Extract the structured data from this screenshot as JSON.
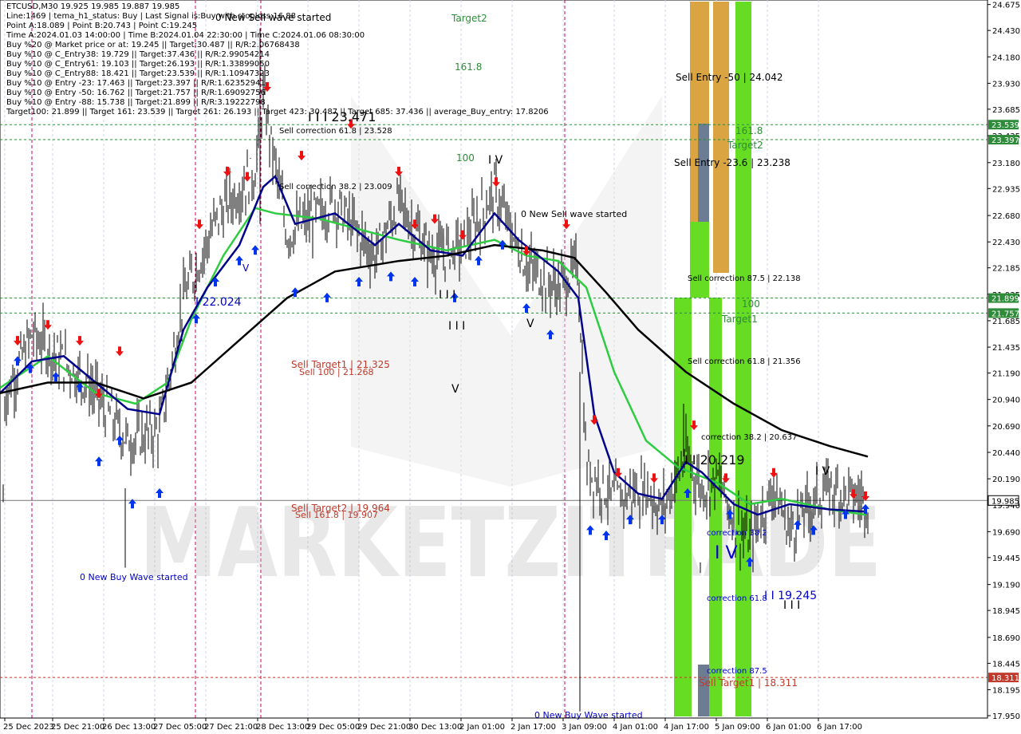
{
  "chart_data": {
    "type": "candlestick",
    "symbol_header": "ETCUSD,M30  19.925 19.985 19.887 19.985",
    "info_lines": [
      "Line:1469 | tema_h1_status: Buy | Last Signal is:Buy with stoploss:16.88",
      "Point A:18.089 | Point B:20.743 | Point C:19.245",
      "Time A:2024.01.03 14:00:00 | Time B:2024.01.04 22:30:00 | Time C:2024.01.06 08:30:00",
      "Buy %20 @ Market price or at: 19.245 || Target:30.487 || R/R:2.06768438",
      "Buy %10 @ C_Entry38: 19.729 || Target:37.436 || R/R:2.99054214",
      "Buy %10 @ C_Entry61: 19.103 || Target:26.193 || R/R:1.33899050",
      "Buy %10 @ C_Entry88: 18.421 || Target:23.539 || R/R:1.10947323",
      "Buy %10 @ Entry -23: 17.463 || Target:23.397 || R/R:1.62352941",
      "Buy %10 @ Entry -50: 16.762 || Target:21.757 || R/R:1.69092756",
      "Buy %10 @ Entry -88: 15.738 || Target:21.899 || R/R:3.19222798",
      "Target100: 21.899 || Target 161: 23.539 || Target 261: 26.193 || Target 423: 30.487 || Target 685: 37.436 || average_Buy_entry: 17.8206"
    ],
    "y_ticks": [
      "24.675",
      "24.430",
      "24.180",
      "23.930",
      "23.685",
      "23.435",
      "23.180",
      "22.935",
      "22.680",
      "22.430",
      "22.185",
      "21.935",
      "21.685",
      "21.435",
      "21.190",
      "20.940",
      "20.690",
      "20.440",
      "20.190",
      "19.940",
      "19.690",
      "19.445",
      "19.190",
      "18.945",
      "18.690",
      "18.445",
      "18.195",
      "17.950"
    ],
    "x_ticks": [
      "25 Dec 2023",
      "25 Dec 21:00",
      "26 Dec 13:00",
      "27 Dec 05:00",
      "27 Dec 21:00",
      "28 Dec 13:00",
      "29 Dec 05:00",
      "29 Dec 21:00",
      "30 Dec 13:00",
      "2 Jan 01:00",
      "2 Jan 17:00",
      "3 Jan 09:00",
      "4 Jan 01:00",
      "4 Jan 17:00",
      "5 Jan 09:00",
      "6 Jan 01:00",
      "6 Jan 17:00"
    ],
    "price_tags": [
      {
        "value": "23.539",
        "color": "#2e8b3a"
      },
      {
        "value": "23.397",
        "color": "#2e8b3a"
      },
      {
        "value": "21.899",
        "color": "#2e8b3a"
      },
      {
        "value": "21.757",
        "color": "#2e8b3a"
      },
      {
        "value": "19.985",
        "color": "#ffffff"
      },
      {
        "value": "18.311",
        "color": "#c0392b"
      }
    ],
    "annotations": [
      {
        "text": "Target2",
        "color": "#2e8b3a"
      },
      {
        "text": "161.8",
        "color": "#2e8b3a"
      },
      {
        "text": "100",
        "color": "#2e8b3a"
      },
      {
        "text": "0 New Sell wave started",
        "color": "#000000"
      },
      {
        "text": "0 New Sell wave started",
        "color": "#000000"
      },
      {
        "text": "0 New Buy Wave started",
        "color": "#0000cc"
      },
      {
        "text": "0 New Buy Wave started",
        "color": "#0000cc"
      },
      {
        "text": "Sell correction 61.8 | 23.528",
        "color": "#000000"
      },
      {
        "text": "Sell correction 38.2 | 23.009",
        "color": "#000000"
      },
      {
        "text": "I I I 23.471",
        "color": "#000000"
      },
      {
        "text": "I 22.024",
        "color": "#0000cc"
      },
      {
        "text": "Sell Target1 | 21.325",
        "color": "#c0392b"
      },
      {
        "text": "Sell 100 | 21.268",
        "color": "#c0392b"
      },
      {
        "text": "Sell Target2 | 19.964",
        "color": "#c0392b"
      },
      {
        "text": "Sell 161.8 | 19.907",
        "color": "#c0392b"
      },
      {
        "text": "I V",
        "color": "#000000"
      },
      {
        "text": "I V",
        "color": "#000000"
      },
      {
        "text": "I I I",
        "color": "#000000"
      },
      {
        "text": "I I I",
        "color": "#000000"
      },
      {
        "text": "V",
        "color": "#000000"
      },
      {
        "text": "V",
        "color": "#000000"
      },
      {
        "text": "V",
        "color": "#0000cc"
      },
      {
        "text": "Sell Entry -50 | 24.042",
        "color": "#000000"
      },
      {
        "text": "161.8",
        "color": "#2e8b3a"
      },
      {
        "text": "Target2",
        "color": "#2e8b3a"
      },
      {
        "text": "Sell Entry -23.6 | 23.238",
        "color": "#000000"
      },
      {
        "text": "Sell correction 87.5 | 22.138",
        "color": "#000000"
      },
      {
        "text": "100",
        "color": "#2e8b3a"
      },
      {
        "text": "Target1",
        "color": "#2e8b3a"
      },
      {
        "text": "Sell correction 61.8 | 21.356",
        "color": "#000000"
      },
      {
        "text": "correction 38.2 | 20.637",
        "color": "#000000"
      },
      {
        "text": "I I 20.219",
        "color": "#000000"
      },
      {
        "text": "correction 38.2",
        "color": "#0000cc"
      },
      {
        "text": "I V",
        "color": "#0000cc"
      },
      {
        "text": "correction 61.8",
        "color": "#0000cc"
      },
      {
        "text": "I I 19.245",
        "color": "#0000cc"
      },
      {
        "text": "I I I",
        "color": "#000000"
      },
      {
        "text": "I V",
        "color": "#000000"
      },
      {
        "text": "correction 87.5",
        "color": "#0000cc"
      },
      {
        "text": "Sell Target1 | 18.311",
        "color": "#c0392b"
      }
    ],
    "watermark": "MARKETZITRADE",
    "series": [
      {
        "name": "price",
        "color": "#000000"
      },
      {
        "name": "fast",
        "color": "#00008b"
      },
      {
        "name": "mid",
        "color": "#2ecc40"
      },
      {
        "name": "slow",
        "color": "#000000"
      }
    ],
    "colors": {
      "grid": "#c8d4e6",
      "vline": "#cc0066",
      "green_zone": "#66dd22",
      "orange_zone": "#d9a441",
      "gray_zone": "#6b7c93"
    }
  }
}
